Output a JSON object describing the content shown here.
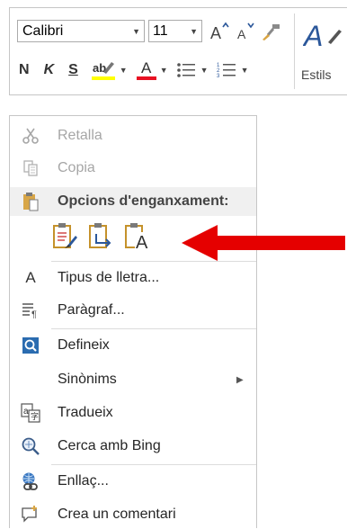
{
  "mini_toolbar": {
    "font_name": "Calibri",
    "font_size": "11",
    "bold": "N",
    "italic": "K",
    "underline": "S",
    "font_color_letter": "A",
    "styles_label": "Estils",
    "highlight_color": "#ffff00",
    "font_color": "#e81123"
  },
  "context_menu": {
    "items": [
      {
        "label": "Retalla",
        "icon": "scissors-icon",
        "enabled": false
      },
      {
        "label": "Copia",
        "icon": "copy-icon",
        "enabled": false
      },
      {
        "label": "Opcions d'enganxament:",
        "icon": "clipboard-icon",
        "header": true
      },
      {
        "label": "Tipus de lletra...",
        "icon": "font-icon"
      },
      {
        "label": "Paràgraf...",
        "icon": "paragraph-icon"
      },
      {
        "label": "Defineix",
        "icon": "define-icon"
      },
      {
        "label": "Sinònims",
        "icon": "",
        "submenu": true
      },
      {
        "label": "Tradueix",
        "icon": "translate-icon"
      },
      {
        "label": "Cerca amb Bing",
        "icon": "search-icon"
      },
      {
        "label": "Enllaç...",
        "icon": "link-icon"
      },
      {
        "label": "Crea un comentari",
        "icon": "comment-icon"
      }
    ],
    "paste_options": [
      "keep-source-formatting",
      "merge-formatting",
      "keep-text-only"
    ],
    "paste_text_only_letter": "A",
    "annotation_arrow_color": "#e50000"
  }
}
